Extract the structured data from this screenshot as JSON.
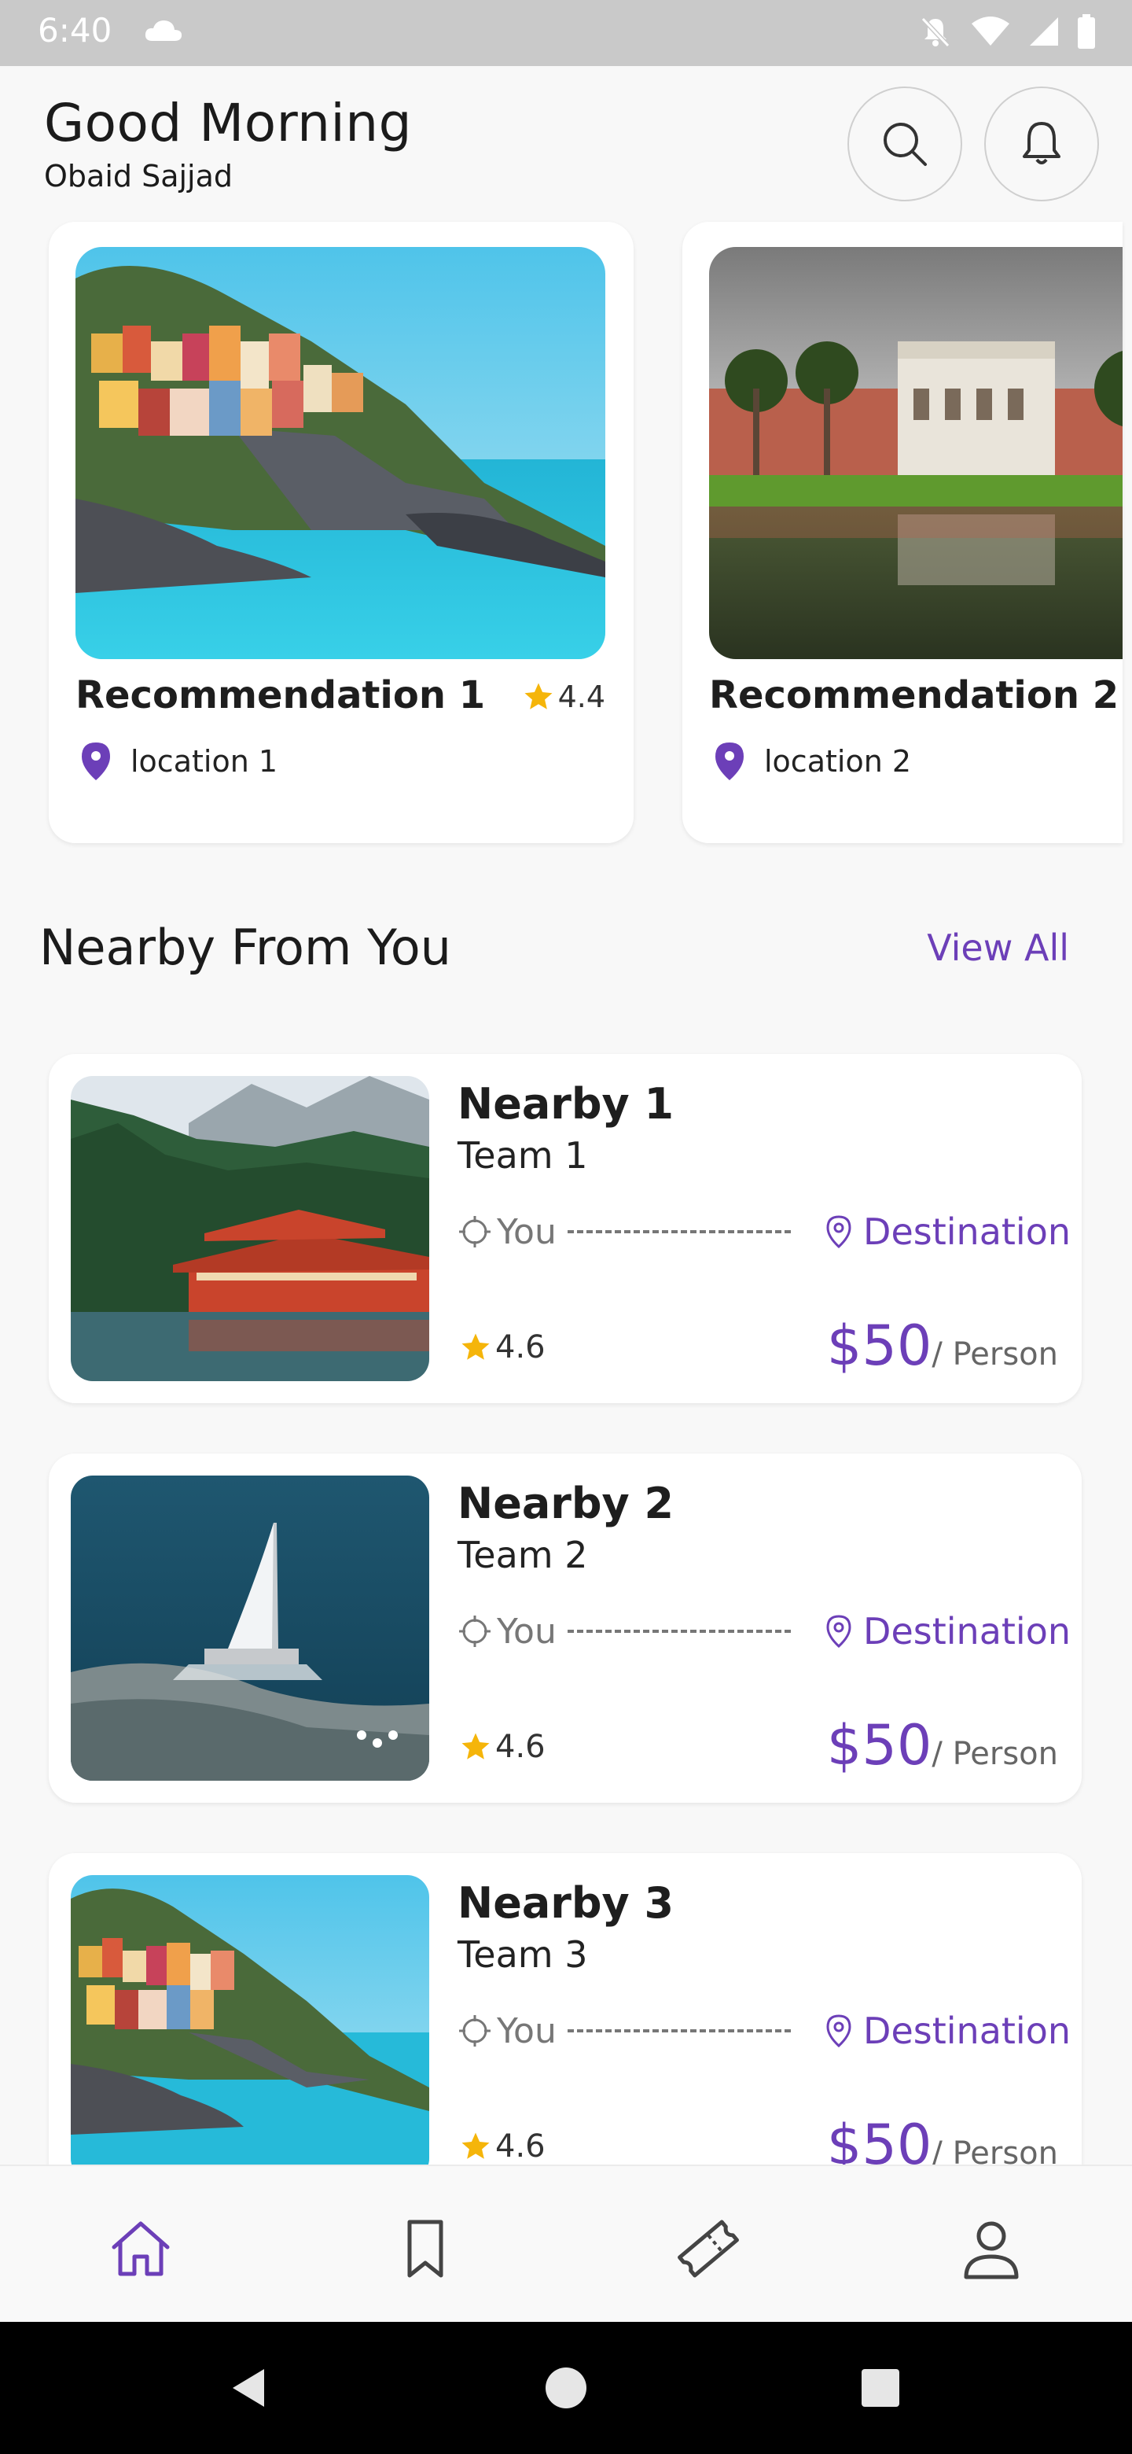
{
  "status_bar": {
    "time": "6:40"
  },
  "header": {
    "greeting": "Good Morning",
    "user_name": "Obaid Sajjad"
  },
  "recommendations": [
    {
      "title": "Recommendation 1",
      "rating": "4.4",
      "location": "location 1"
    },
    {
      "title": "Recommendation 2",
      "location": "location 2"
    }
  ],
  "nearby_section": {
    "title": "Nearby From You",
    "view_all": "View All"
  },
  "nearby": [
    {
      "title": "Nearby 1",
      "team": "Team 1",
      "from": "You",
      "to": "Destination",
      "rating": "4.6",
      "price": "$50",
      "unit": "/ Person"
    },
    {
      "title": "Nearby 2",
      "team": "Team 2",
      "from": "You",
      "to": "Destination",
      "rating": "4.6",
      "price": "$50",
      "unit": "/ Person"
    },
    {
      "title": "Nearby 3",
      "team": "Team 3",
      "from": "You",
      "to": "Destination",
      "rating": "4.6",
      "price": "$50",
      "unit": "/ Person"
    }
  ],
  "bottom_nav": [
    "home-icon",
    "bookmark-icon",
    "ticket-icon",
    "profile-icon"
  ],
  "colors": {
    "accent": "#6c3fb8",
    "star": "#f5b50a",
    "background": "#f8f8f8"
  }
}
